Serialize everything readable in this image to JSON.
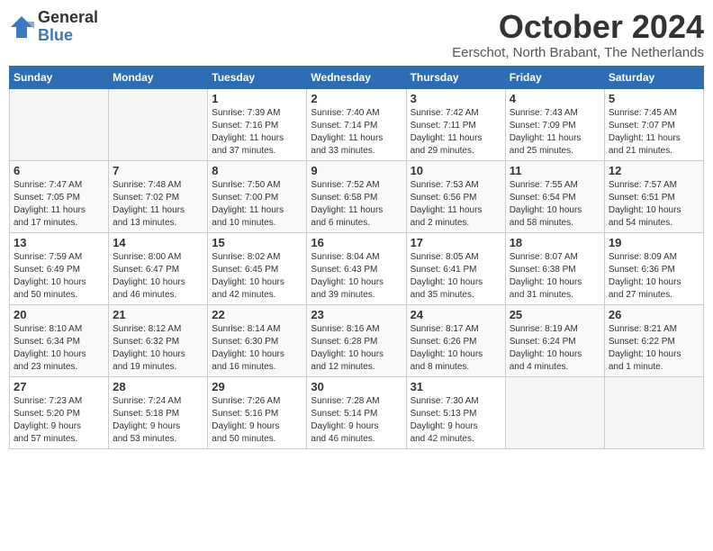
{
  "logo": {
    "general": "General",
    "blue": "Blue"
  },
  "title": "October 2024",
  "subtitle": "Eerschot, North Brabant, The Netherlands",
  "days_of_week": [
    "Sunday",
    "Monday",
    "Tuesday",
    "Wednesday",
    "Thursday",
    "Friday",
    "Saturday"
  ],
  "weeks": [
    [
      {
        "day": "",
        "info": ""
      },
      {
        "day": "",
        "info": ""
      },
      {
        "day": "1",
        "info": "Sunrise: 7:39 AM\nSunset: 7:16 PM\nDaylight: 11 hours\nand 37 minutes."
      },
      {
        "day": "2",
        "info": "Sunrise: 7:40 AM\nSunset: 7:14 PM\nDaylight: 11 hours\nand 33 minutes."
      },
      {
        "day": "3",
        "info": "Sunrise: 7:42 AM\nSunset: 7:11 PM\nDaylight: 11 hours\nand 29 minutes."
      },
      {
        "day": "4",
        "info": "Sunrise: 7:43 AM\nSunset: 7:09 PM\nDaylight: 11 hours\nand 25 minutes."
      },
      {
        "day": "5",
        "info": "Sunrise: 7:45 AM\nSunset: 7:07 PM\nDaylight: 11 hours\nand 21 minutes."
      }
    ],
    [
      {
        "day": "6",
        "info": "Sunrise: 7:47 AM\nSunset: 7:05 PM\nDaylight: 11 hours\nand 17 minutes."
      },
      {
        "day": "7",
        "info": "Sunrise: 7:48 AM\nSunset: 7:02 PM\nDaylight: 11 hours\nand 13 minutes."
      },
      {
        "day": "8",
        "info": "Sunrise: 7:50 AM\nSunset: 7:00 PM\nDaylight: 11 hours\nand 10 minutes."
      },
      {
        "day": "9",
        "info": "Sunrise: 7:52 AM\nSunset: 6:58 PM\nDaylight: 11 hours\nand 6 minutes."
      },
      {
        "day": "10",
        "info": "Sunrise: 7:53 AM\nSunset: 6:56 PM\nDaylight: 11 hours\nand 2 minutes."
      },
      {
        "day": "11",
        "info": "Sunrise: 7:55 AM\nSunset: 6:54 PM\nDaylight: 10 hours\nand 58 minutes."
      },
      {
        "day": "12",
        "info": "Sunrise: 7:57 AM\nSunset: 6:51 PM\nDaylight: 10 hours\nand 54 minutes."
      }
    ],
    [
      {
        "day": "13",
        "info": "Sunrise: 7:59 AM\nSunset: 6:49 PM\nDaylight: 10 hours\nand 50 minutes."
      },
      {
        "day": "14",
        "info": "Sunrise: 8:00 AM\nSunset: 6:47 PM\nDaylight: 10 hours\nand 46 minutes."
      },
      {
        "day": "15",
        "info": "Sunrise: 8:02 AM\nSunset: 6:45 PM\nDaylight: 10 hours\nand 42 minutes."
      },
      {
        "day": "16",
        "info": "Sunrise: 8:04 AM\nSunset: 6:43 PM\nDaylight: 10 hours\nand 39 minutes."
      },
      {
        "day": "17",
        "info": "Sunrise: 8:05 AM\nSunset: 6:41 PM\nDaylight: 10 hours\nand 35 minutes."
      },
      {
        "day": "18",
        "info": "Sunrise: 8:07 AM\nSunset: 6:38 PM\nDaylight: 10 hours\nand 31 minutes."
      },
      {
        "day": "19",
        "info": "Sunrise: 8:09 AM\nSunset: 6:36 PM\nDaylight: 10 hours\nand 27 minutes."
      }
    ],
    [
      {
        "day": "20",
        "info": "Sunrise: 8:10 AM\nSunset: 6:34 PM\nDaylight: 10 hours\nand 23 minutes."
      },
      {
        "day": "21",
        "info": "Sunrise: 8:12 AM\nSunset: 6:32 PM\nDaylight: 10 hours\nand 19 minutes."
      },
      {
        "day": "22",
        "info": "Sunrise: 8:14 AM\nSunset: 6:30 PM\nDaylight: 10 hours\nand 16 minutes."
      },
      {
        "day": "23",
        "info": "Sunrise: 8:16 AM\nSunset: 6:28 PM\nDaylight: 10 hours\nand 12 minutes."
      },
      {
        "day": "24",
        "info": "Sunrise: 8:17 AM\nSunset: 6:26 PM\nDaylight: 10 hours\nand 8 minutes."
      },
      {
        "day": "25",
        "info": "Sunrise: 8:19 AM\nSunset: 6:24 PM\nDaylight: 10 hours\nand 4 minutes."
      },
      {
        "day": "26",
        "info": "Sunrise: 8:21 AM\nSunset: 6:22 PM\nDaylight: 10 hours\nand 1 minute."
      }
    ],
    [
      {
        "day": "27",
        "info": "Sunrise: 7:23 AM\nSunset: 5:20 PM\nDaylight: 9 hours\nand 57 minutes."
      },
      {
        "day": "28",
        "info": "Sunrise: 7:24 AM\nSunset: 5:18 PM\nDaylight: 9 hours\nand 53 minutes."
      },
      {
        "day": "29",
        "info": "Sunrise: 7:26 AM\nSunset: 5:16 PM\nDaylight: 9 hours\nand 50 minutes."
      },
      {
        "day": "30",
        "info": "Sunrise: 7:28 AM\nSunset: 5:14 PM\nDaylight: 9 hours\nand 46 minutes."
      },
      {
        "day": "31",
        "info": "Sunrise: 7:30 AM\nSunset: 5:13 PM\nDaylight: 9 hours\nand 42 minutes."
      },
      {
        "day": "",
        "info": ""
      },
      {
        "day": "",
        "info": ""
      }
    ]
  ]
}
